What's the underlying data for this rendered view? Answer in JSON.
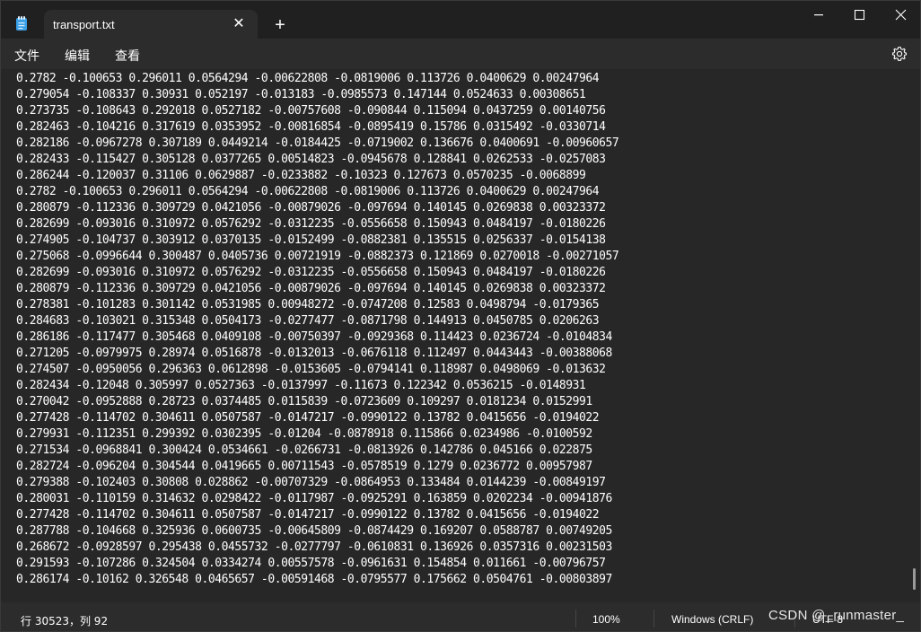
{
  "window": {
    "tab_title": "transport.txt",
    "close_tab_glyph": "✕",
    "new_tab_glyph": "+"
  },
  "menu": {
    "file": "文件",
    "edit": "编辑",
    "view": "查看"
  },
  "icons": {
    "app": "notepad-icon",
    "settings": "gear-icon",
    "minimize": "minimize-icon",
    "maximize": "maximize-icon",
    "close": "close-icon"
  },
  "editor": {
    "lines": [
      "0.2782 -0.100653 0.296011 0.0564294 -0.00622808 -0.0819006 0.113726 0.0400629 0.00247964",
      "0.279054 -0.108337 0.30931 0.052197 -0.013183 -0.0985573 0.147144 0.0524633 0.00308651",
      "0.273735 -0.108643 0.292018 0.0527182 -0.00757608 -0.090844 0.115094 0.0437259 0.00140756",
      "0.282463 -0.104216 0.317619 0.0353952 -0.00816854 -0.0895419 0.15786 0.0315492 -0.0330714",
      "0.282186 -0.0967278 0.307189 0.0449214 -0.0184425 -0.0719002 0.136676 0.0400691 -0.00960657",
      "0.282433 -0.115427 0.305128 0.0377265 0.00514823 -0.0945678 0.128841 0.0262533 -0.0257083",
      "0.286244 -0.120037 0.31106 0.0629887 -0.0233882 -0.10323 0.127673 0.0570235 -0.0068899",
      "0.2782 -0.100653 0.296011 0.0564294 -0.00622808 -0.0819006 0.113726 0.0400629 0.00247964",
      "0.280879 -0.112336 0.309729 0.0421056 -0.00879026 -0.097694 0.140145 0.0269838 0.00323372",
      "0.282699 -0.093016 0.310972 0.0576292 -0.0312235 -0.0556658 0.150943 0.0484197 -0.0180226",
      "0.274905 -0.104737 0.303912 0.0370135 -0.0152499 -0.0882381 0.135515 0.0256337 -0.0154138",
      "0.275068 -0.0996644 0.300487 0.0405736 0.00721919 -0.0882373 0.121869 0.0270018 -0.00271057",
      "0.282699 -0.093016 0.310972 0.0576292 -0.0312235 -0.0556658 0.150943 0.0484197 -0.0180226",
      "0.280879 -0.112336 0.309729 0.0421056 -0.00879026 -0.097694 0.140145 0.0269838 0.00323372",
      "0.278381 -0.101283 0.301142 0.0531985 0.00948272 -0.0747208 0.12583 0.0498794 -0.0179365",
      "0.284683 -0.103021 0.315348 0.0504173 -0.0277477 -0.0871798 0.144913 0.0450785 0.0206263",
      "0.286186 -0.117477 0.305468 0.0409108 -0.00750397 -0.0929368 0.114423 0.0236724 -0.0104834",
      "0.271205 -0.0979975 0.28974 0.0516878 -0.0132013 -0.0676118 0.112497 0.0443443 -0.00388068",
      "0.274507 -0.0950056 0.296363 0.0612898 -0.0153605 -0.0794141 0.118987 0.0498069 -0.013632",
      "0.282434 -0.12048 0.305997 0.0527363 -0.0137997 -0.11673 0.122342 0.0536215 -0.0148931",
      "0.270042 -0.0952888 0.28723 0.0374485 0.0115839 -0.0723609 0.109297 0.0181234 0.0152991",
      "0.277428 -0.114702 0.304611 0.0507587 -0.0147217 -0.0990122 0.13782 0.0415656 -0.0194022",
      "0.279931 -0.112351 0.299392 0.0302395 -0.01204 -0.0878918 0.115866 0.0234986 -0.0100592",
      "0.271534 -0.0968841 0.300424 0.0534661 -0.0266731 -0.0813926 0.142786 0.045166 0.022875",
      "0.282724 -0.096204 0.304544 0.0419665 0.00711543 -0.0578519 0.1279 0.0236772 0.00957987",
      "0.279388 -0.102403 0.30808 0.028862 -0.00707329 -0.0864953 0.133484 0.0144239 -0.00849197",
      "0.280031 -0.110159 0.314632 0.0298422 -0.0117987 -0.0925291 0.163859 0.0202234 -0.00941876",
      "0.277428 -0.114702 0.304611 0.0507587 -0.0147217 -0.0990122 0.13782 0.0415656 -0.0194022",
      "0.287788 -0.104668 0.325936 0.0600735 -0.00645809 -0.0874429 0.169207 0.0588787 0.00749205",
      "0.268672 -0.0928597 0.295438 0.0455732 -0.0277797 -0.0610831 0.136926 0.0357316 0.00231503",
      "0.291593 -0.107286 0.324504 0.0334274 0.00557578 -0.0961631 0.154854 0.011661 -0.00796757",
      "0.286174 -0.10162 0.326548 0.0465657 -0.00591468 -0.0795577 0.175662 0.0504761 -0.00803897"
    ]
  },
  "status": {
    "position": "行 30523，列 92",
    "zoom": "100%",
    "line_ending": "Windows (CRLF)",
    "encoding": "UTF-8"
  },
  "watermark": "CSDN @_runmaster_",
  "colors": {
    "editor_bg": "#272727",
    "chrome_bg": "#202020",
    "menu_bg": "#2c2c2c",
    "text": "#ffffff"
  }
}
